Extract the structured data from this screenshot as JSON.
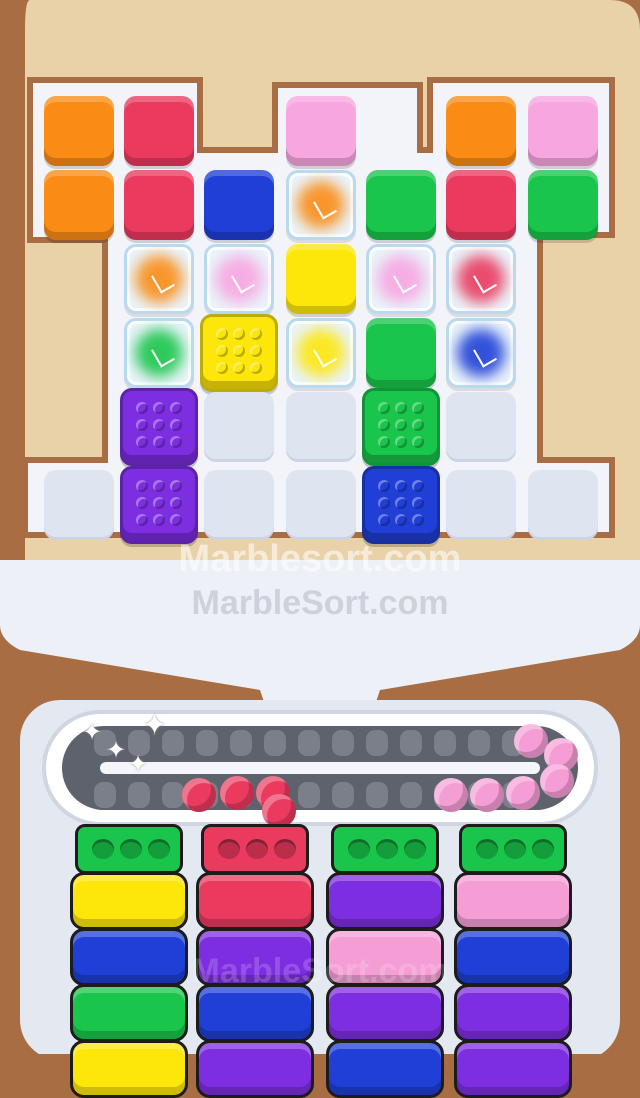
{
  "colors": {
    "orange": "#fa8c16",
    "red": "#ea3a5e",
    "pink": "#f7a6e0",
    "blue": "#1f3fd6",
    "green": "#19c54a",
    "yellow": "#fde60a",
    "purple": "#7d2ee0",
    "pale_pink": "#f59ed5"
  },
  "watermark": {
    "primary": "Marblesort.com",
    "secondary": "MarbleSort.com",
    "faint": "MarbleSort.com"
  },
  "board": {
    "rows": [
      [
        "orange",
        "red",
        null,
        "pink",
        null,
        "orange",
        "pink"
      ],
      [
        "orange",
        "red",
        "blue",
        "ice:orange",
        "green",
        "red",
        "green"
      ],
      [
        null,
        "ice:orange",
        "ice:pink",
        "yellow",
        "ice:pink",
        "ice:red",
        null
      ],
      [
        null,
        "ice:green",
        "pegs:yellow",
        "ice:yellow",
        "green",
        "ice:blue",
        null
      ],
      [
        null,
        "pegs:purple",
        "empty",
        "empty",
        "pegs:green",
        "empty",
        null
      ],
      [
        "empty",
        "pegs:purple",
        "empty",
        "empty",
        "pegs:blue",
        "empty",
        "empty"
      ]
    ]
  },
  "conveyor": {
    "red_marbles": 4,
    "pink_marbles": 6
  },
  "columns": [
    {
      "top": "green",
      "blocks": [
        "yellow",
        "blue",
        "green",
        "yellow"
      ]
    },
    {
      "top": "red",
      "blocks": [
        "red",
        "purple",
        "blue",
        "purple"
      ]
    },
    {
      "top": "green",
      "blocks": [
        "purple",
        "pale_pink",
        "purple",
        "blue"
      ]
    },
    {
      "top": "green",
      "blocks": [
        "pale_pink",
        "blue",
        "purple",
        "purple"
      ]
    }
  ]
}
